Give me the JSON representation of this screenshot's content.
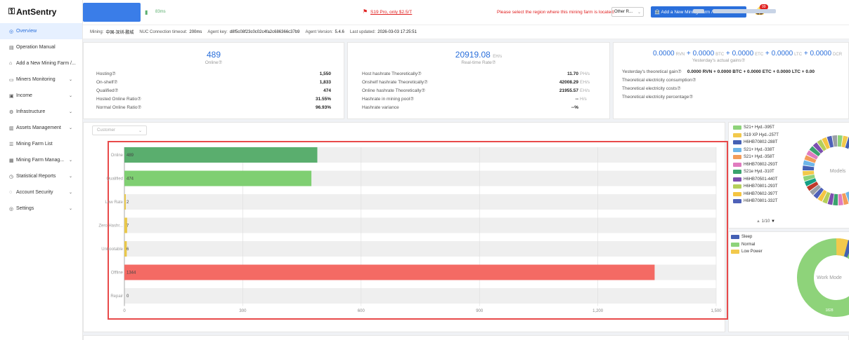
{
  "brand": {
    "name": "AntSentry"
  },
  "sidebar": {
    "items": [
      {
        "label": "Overview",
        "icon": "circle-icon",
        "active": true,
        "chevron": false
      },
      {
        "label": "Operation Manual",
        "icon": "book-icon",
        "chevron": false
      },
      {
        "label": "Add a New Mining Farm /...",
        "icon": "bank-icon",
        "chevron": false
      },
      {
        "label": "Miners Monitoring",
        "icon": "monitor-icon",
        "chevron": true
      },
      {
        "label": "Income",
        "icon": "money-icon",
        "chevron": true
      },
      {
        "label": "Infrastructure",
        "icon": "gear-icon",
        "chevron": true
      },
      {
        "label": "Assets Management",
        "icon": "database-icon",
        "chevron": true
      },
      {
        "label": "Mining Farm List",
        "icon": "list-icon",
        "chevron": false
      },
      {
        "label": "Mining Farm Manag...",
        "icon": "table-icon",
        "chevron": true
      },
      {
        "label": "Statistical Reports",
        "icon": "chart-icon",
        "chevron": true
      },
      {
        "label": "Account Security",
        "icon": "shield-icon",
        "chevron": true
      },
      {
        "label": "Settings",
        "icon": "settings-icon",
        "chevron": true
      }
    ]
  },
  "topbar": {
    "latency": "83ms",
    "promo": "S19 Pro, only $2.5/T",
    "region_prompt": "Please select the region where this mining farm is located:",
    "region_value": "Other R...",
    "add_button": "Add a New Mining Farm / Download",
    "notif_count": "99"
  },
  "infobar": {
    "mining_label": "Mining:",
    "mining_value": "中国-深圳-鹏城",
    "nuc_label": "NUC Connection timeout:",
    "nuc_value": "200ms",
    "agent_key_label": "Agent key:",
    "agent_key_value": "d8f5c08f23c0c02c4fa2c686366c37b9",
    "agent_version_label": "Agent Version:",
    "agent_version_value": "5.4.6",
    "updated_label": "Last updated:",
    "updated_value": "2026-03-03 17:25:51"
  },
  "card1": {
    "big": "489",
    "sub": "Online⑦",
    "rows": [
      {
        "label": "Hosting⑦",
        "value": "1,550"
      },
      {
        "label": "On-shelf⑦",
        "value": "1,833"
      },
      {
        "label": "Qualified⑦",
        "value": "474"
      },
      {
        "label": "Hosted Online Ratio⑦",
        "value": "31.55%"
      },
      {
        "label": "Normal Online Ratio⑦",
        "value": "96.93%"
      }
    ]
  },
  "card2": {
    "big": "20919.08",
    "big_unit": "EH/s",
    "sub": "Real-time Rate⑦",
    "rows": [
      {
        "label": "Host hashrate Theoretically⑦",
        "value": "11.70",
        "unit": "PH/s"
      },
      {
        "label": "Onshelf hashrate Theoretically⑦",
        "value": "42008.29",
        "unit": "EH/s"
      },
      {
        "label": "Online hashrate Theoretically⑦",
        "value": "21955.57",
        "unit": "EH/s"
      },
      {
        "label": "Hashrate in mining pool⑦",
        "value": "--",
        "unit": "H/s"
      },
      {
        "label": "Hashrate variance",
        "value": "--%",
        "unit": ""
      }
    ]
  },
  "card3": {
    "big": [
      {
        "v": "0.0000",
        "u": "RVN"
      },
      {
        "v": "0.0000",
        "u": "BTC"
      },
      {
        "v": "0.0000",
        "u": "ETC"
      },
      {
        "v": "0.0000",
        "u": "LTC"
      },
      {
        "v": "0.0000",
        "u": "DCR"
      }
    ],
    "sub": "Yesterday's actual gains⑦",
    "rows": [
      {
        "label": "Yesterday's theoretical gain⑦",
        "value": "0.0000 RVN + 0.0000 BTC + 0.0000 ETC + 0.0000 LTC + 0.00"
      },
      {
        "label": "Theoretical electricity consumption⑦",
        "value": ""
      },
      {
        "label": "Theoretical electricity costs⑦",
        "value": ""
      },
      {
        "label": "Theoretical electricity percentage⑦",
        "value": ""
      }
    ]
  },
  "filter": {
    "placeholder": "Customer"
  },
  "chart_data": {
    "type": "bar",
    "orientation": "horizontal",
    "categories": [
      "Online",
      "Qualified",
      "Low Rate",
      "Zero Hashr...",
      "Unbootable",
      "Offline",
      "Repair"
    ],
    "values": [
      489,
      474,
      2,
      7,
      6,
      1344,
      0
    ],
    "colors": [
      "#5aae6e",
      "#7fcf72",
      "#e9c84a",
      "#e9c84a",
      "#e9c84a",
      "#f46a64",
      "#cccccc"
    ],
    "xlim": [
      0,
      1500
    ],
    "xticks": [
      "0",
      "300",
      "600",
      "900",
      "1,200",
      "1,500"
    ],
    "grid": true
  },
  "models_legend": {
    "items": [
      {
        "label": "S21+ Hyd.-395T",
        "color": "#8ed37a"
      },
      {
        "label": "S19 XP Hyd.-257T",
        "color": "#f2c94c"
      },
      {
        "label": "H6HB70802-288T",
        "color": "#4460b4"
      },
      {
        "label": "S21+ Hyd.-338T",
        "color": "#6fb6e8"
      },
      {
        "label": "S21+ Hyd.-358T",
        "color": "#f39c5a"
      },
      {
        "label": "H6HB70802-293T",
        "color": "#e07bbf"
      },
      {
        "label": "S21e Hyd.-310T",
        "color": "#3aa36e"
      },
      {
        "label": "H6HB70501-440T",
        "color": "#7d4fb0"
      },
      {
        "label": "H6HB70801-293T",
        "color": "#b5cf5a"
      },
      {
        "label": "H6HB70602-397T",
        "color": "#f5c542"
      },
      {
        "label": "H6HB70801-332T",
        "color": "#4e61b8"
      }
    ],
    "pager": "1/10",
    "center_label": "Models"
  },
  "workmode": {
    "items": [
      {
        "label": "Sleep",
        "color": "#4460b4"
      },
      {
        "label": "Normal",
        "color": "#8ed37a"
      },
      {
        "label": "Low Power",
        "color": "#f2c94c"
      }
    ],
    "center_label": "Work Mode",
    "value_label": "1828"
  }
}
